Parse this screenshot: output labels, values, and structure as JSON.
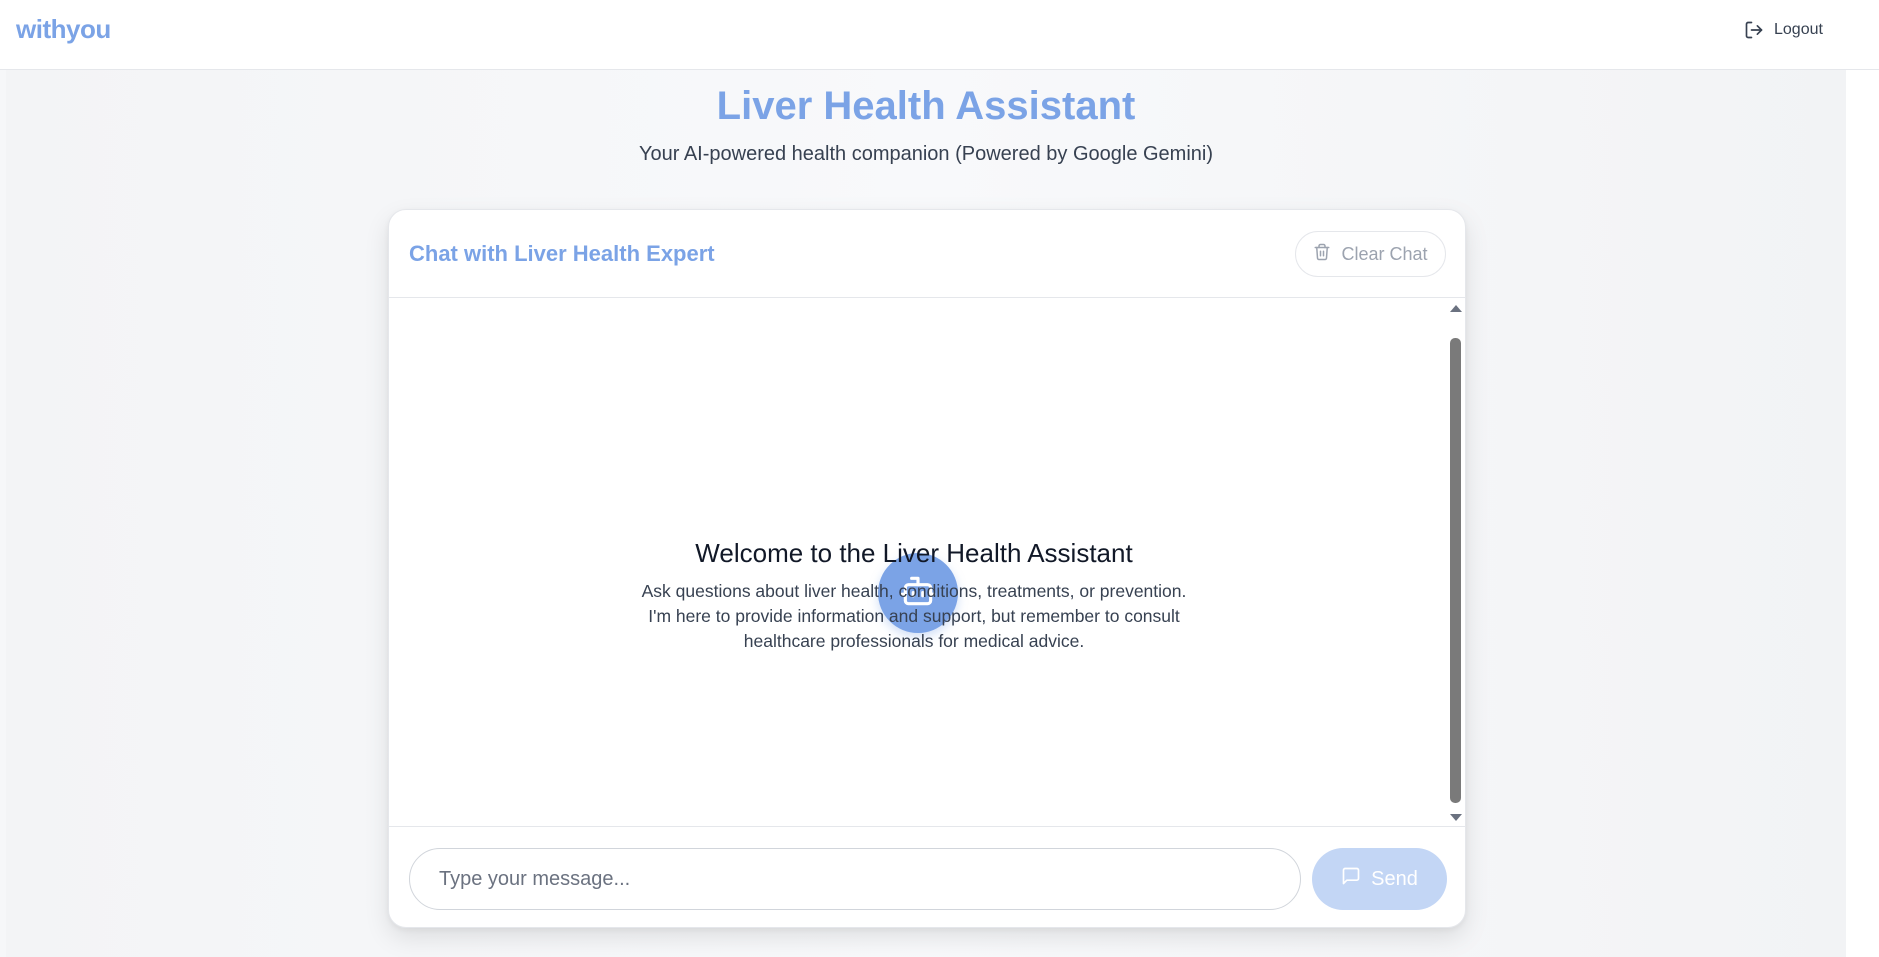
{
  "app": {
    "brand": "withyou",
    "logout_label": "Logout"
  },
  "hero": {
    "title": "Liver Health Assistant",
    "subtitle": "Your AI-powered health companion (Powered by Google Gemini)"
  },
  "chat": {
    "title": "Chat with Liver Health Expert",
    "clear_label": "Clear Chat",
    "welcome_title": "Welcome to the Liver Health Assistant",
    "welcome_lines": [
      "Ask questions about liver health, conditions, treatments, or prevention.",
      "I'm here to provide information and support, but remember to consult",
      "healthcare professionals for medical advice."
    ],
    "input_placeholder": "Type your message...",
    "send_label": "Send"
  },
  "colors": {
    "brand": "#7ba3e6",
    "send_disabled": "#c3d6f5",
    "muted": "#9ca3af"
  },
  "icons": {
    "logout": "logout-icon",
    "clear": "trash-icon",
    "bot": "bot-icon",
    "send": "message-square-icon"
  }
}
